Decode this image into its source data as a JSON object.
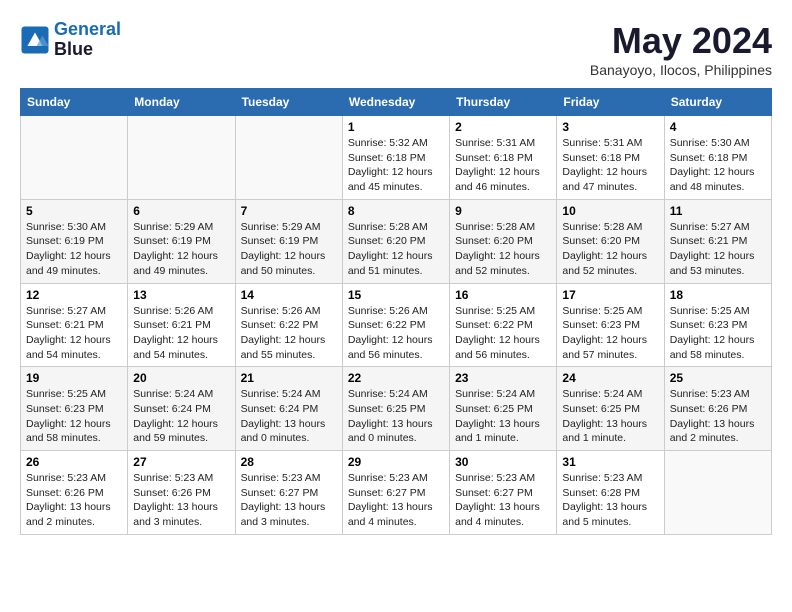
{
  "logo": {
    "line1": "General",
    "line2": "Blue"
  },
  "title": "May 2024",
  "subtitle": "Banayoyo, Ilocos, Philippines",
  "header_days": [
    "Sunday",
    "Monday",
    "Tuesday",
    "Wednesday",
    "Thursday",
    "Friday",
    "Saturday"
  ],
  "weeks": [
    [
      {
        "num": "",
        "info": ""
      },
      {
        "num": "",
        "info": ""
      },
      {
        "num": "",
        "info": ""
      },
      {
        "num": "1",
        "info": "Sunrise: 5:32 AM\nSunset: 6:18 PM\nDaylight: 12 hours and 45 minutes."
      },
      {
        "num": "2",
        "info": "Sunrise: 5:31 AM\nSunset: 6:18 PM\nDaylight: 12 hours and 46 minutes."
      },
      {
        "num": "3",
        "info": "Sunrise: 5:31 AM\nSunset: 6:18 PM\nDaylight: 12 hours and 47 minutes."
      },
      {
        "num": "4",
        "info": "Sunrise: 5:30 AM\nSunset: 6:18 PM\nDaylight: 12 hours and 48 minutes."
      }
    ],
    [
      {
        "num": "5",
        "info": "Sunrise: 5:30 AM\nSunset: 6:19 PM\nDaylight: 12 hours and 49 minutes."
      },
      {
        "num": "6",
        "info": "Sunrise: 5:29 AM\nSunset: 6:19 PM\nDaylight: 12 hours and 49 minutes."
      },
      {
        "num": "7",
        "info": "Sunrise: 5:29 AM\nSunset: 6:19 PM\nDaylight: 12 hours and 50 minutes."
      },
      {
        "num": "8",
        "info": "Sunrise: 5:28 AM\nSunset: 6:20 PM\nDaylight: 12 hours and 51 minutes."
      },
      {
        "num": "9",
        "info": "Sunrise: 5:28 AM\nSunset: 6:20 PM\nDaylight: 12 hours and 52 minutes."
      },
      {
        "num": "10",
        "info": "Sunrise: 5:28 AM\nSunset: 6:20 PM\nDaylight: 12 hours and 52 minutes."
      },
      {
        "num": "11",
        "info": "Sunrise: 5:27 AM\nSunset: 6:21 PM\nDaylight: 12 hours and 53 minutes."
      }
    ],
    [
      {
        "num": "12",
        "info": "Sunrise: 5:27 AM\nSunset: 6:21 PM\nDaylight: 12 hours and 54 minutes."
      },
      {
        "num": "13",
        "info": "Sunrise: 5:26 AM\nSunset: 6:21 PM\nDaylight: 12 hours and 54 minutes."
      },
      {
        "num": "14",
        "info": "Sunrise: 5:26 AM\nSunset: 6:22 PM\nDaylight: 12 hours and 55 minutes."
      },
      {
        "num": "15",
        "info": "Sunrise: 5:26 AM\nSunset: 6:22 PM\nDaylight: 12 hours and 56 minutes."
      },
      {
        "num": "16",
        "info": "Sunrise: 5:25 AM\nSunset: 6:22 PM\nDaylight: 12 hours and 56 minutes."
      },
      {
        "num": "17",
        "info": "Sunrise: 5:25 AM\nSunset: 6:23 PM\nDaylight: 12 hours and 57 minutes."
      },
      {
        "num": "18",
        "info": "Sunrise: 5:25 AM\nSunset: 6:23 PM\nDaylight: 12 hours and 58 minutes."
      }
    ],
    [
      {
        "num": "19",
        "info": "Sunrise: 5:25 AM\nSunset: 6:23 PM\nDaylight: 12 hours and 58 minutes."
      },
      {
        "num": "20",
        "info": "Sunrise: 5:24 AM\nSunset: 6:24 PM\nDaylight: 12 hours and 59 minutes."
      },
      {
        "num": "21",
        "info": "Sunrise: 5:24 AM\nSunset: 6:24 PM\nDaylight: 13 hours and 0 minutes."
      },
      {
        "num": "22",
        "info": "Sunrise: 5:24 AM\nSunset: 6:25 PM\nDaylight: 13 hours and 0 minutes."
      },
      {
        "num": "23",
        "info": "Sunrise: 5:24 AM\nSunset: 6:25 PM\nDaylight: 13 hours and 1 minute."
      },
      {
        "num": "24",
        "info": "Sunrise: 5:24 AM\nSunset: 6:25 PM\nDaylight: 13 hours and 1 minute."
      },
      {
        "num": "25",
        "info": "Sunrise: 5:23 AM\nSunset: 6:26 PM\nDaylight: 13 hours and 2 minutes."
      }
    ],
    [
      {
        "num": "26",
        "info": "Sunrise: 5:23 AM\nSunset: 6:26 PM\nDaylight: 13 hours and 2 minutes."
      },
      {
        "num": "27",
        "info": "Sunrise: 5:23 AM\nSunset: 6:26 PM\nDaylight: 13 hours and 3 minutes."
      },
      {
        "num": "28",
        "info": "Sunrise: 5:23 AM\nSunset: 6:27 PM\nDaylight: 13 hours and 3 minutes."
      },
      {
        "num": "29",
        "info": "Sunrise: 5:23 AM\nSunset: 6:27 PM\nDaylight: 13 hours and 4 minutes."
      },
      {
        "num": "30",
        "info": "Sunrise: 5:23 AM\nSunset: 6:27 PM\nDaylight: 13 hours and 4 minutes."
      },
      {
        "num": "31",
        "info": "Sunrise: 5:23 AM\nSunset: 6:28 PM\nDaylight: 13 hours and 5 minutes."
      },
      {
        "num": "",
        "info": ""
      }
    ]
  ]
}
